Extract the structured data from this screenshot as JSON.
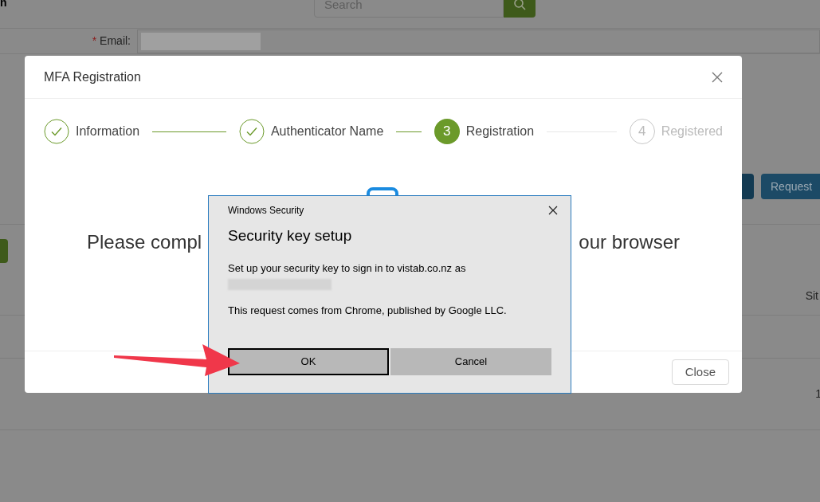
{
  "page": {
    "title_fragment": "n",
    "search": {
      "placeholder": "Search"
    },
    "email_label": "Email:",
    "required_mark": "*",
    "request_button": "Request",
    "column_fragment": "Sit",
    "cell_fragment": "1"
  },
  "modal": {
    "title": "MFA Registration",
    "steps": [
      {
        "kind": "done",
        "label": "Information"
      },
      {
        "kind": "done",
        "label": "Authenticator Name"
      },
      {
        "kind": "current",
        "number": "3",
        "label": "Registration"
      },
      {
        "kind": "pending",
        "number": "4",
        "label": "Registered"
      }
    ],
    "message_start": "Please compl",
    "message_end": "our browser",
    "close_button": "Close"
  },
  "dialog": {
    "app": "Windows Security",
    "title": "Security key setup",
    "text": "Set up your security key to sign in to vistab.co.nz as",
    "note": "This request comes from Chrome, published by Google LLC.",
    "buttons": [
      {
        "label": "OK",
        "selected": true
      },
      {
        "label": "Cancel",
        "selected": false
      }
    ]
  }
}
